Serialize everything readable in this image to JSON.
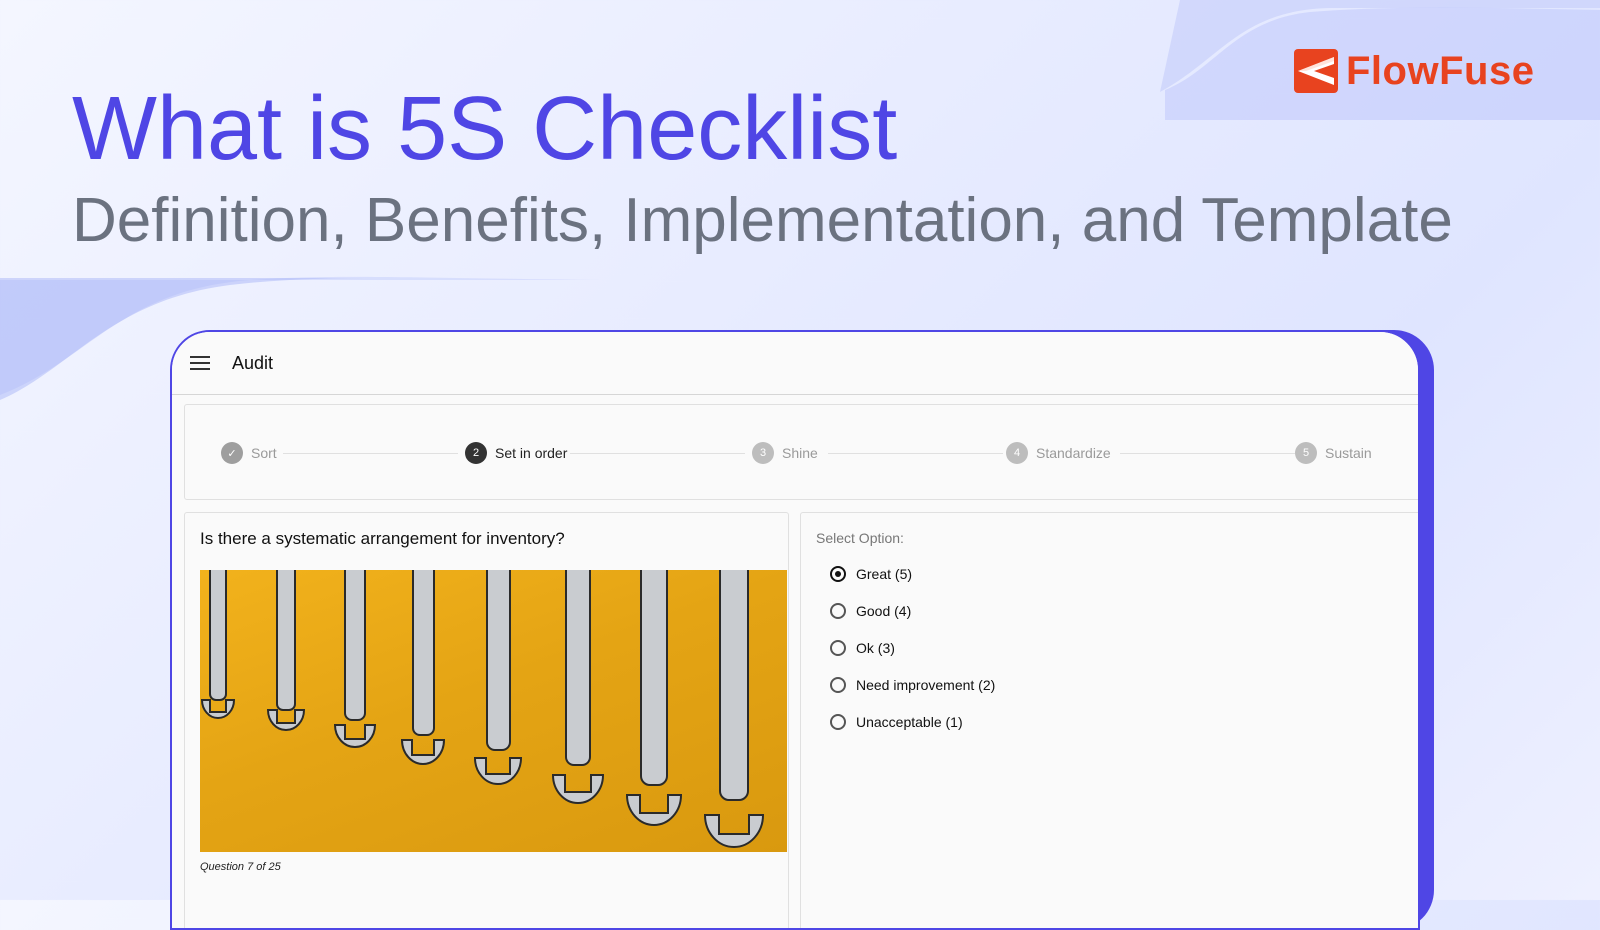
{
  "brand": {
    "name": "FlowFuse",
    "color": "#e8431f"
  },
  "hero": {
    "title": "What is 5S Checklist",
    "subtitle": "Definition, Benefits, Implementation, and Template"
  },
  "app": {
    "title": "Audit",
    "menu_icon": "hamburger-menu-icon",
    "accent": "#4f46e5",
    "steps": [
      {
        "number": "✓",
        "label": "Sort",
        "state": "done",
        "icon": "check-icon"
      },
      {
        "number": "2",
        "label": "Set in order",
        "state": "active"
      },
      {
        "number": "3",
        "label": "Shine",
        "state": "pending"
      },
      {
        "number": "4",
        "label": "Standardize",
        "state": "pending"
      },
      {
        "number": "5",
        "label": "Sustain",
        "state": "pending"
      }
    ],
    "question": {
      "text": "Is there a systematic arrangement for inventory?",
      "image": "wrenches-on-yellow-wall",
      "counter": "Question 7 of 25"
    },
    "options": {
      "label": "Select Option:",
      "selected": "Great (5)",
      "items": [
        {
          "label": "Great (5)",
          "checked": true
        },
        {
          "label": "Good (4)",
          "checked": false
        },
        {
          "label": "Ok (3)",
          "checked": false
        },
        {
          "label": "Need improvement (2)",
          "checked": false
        },
        {
          "label": "Unacceptable (1)",
          "checked": false
        }
      ]
    }
  }
}
